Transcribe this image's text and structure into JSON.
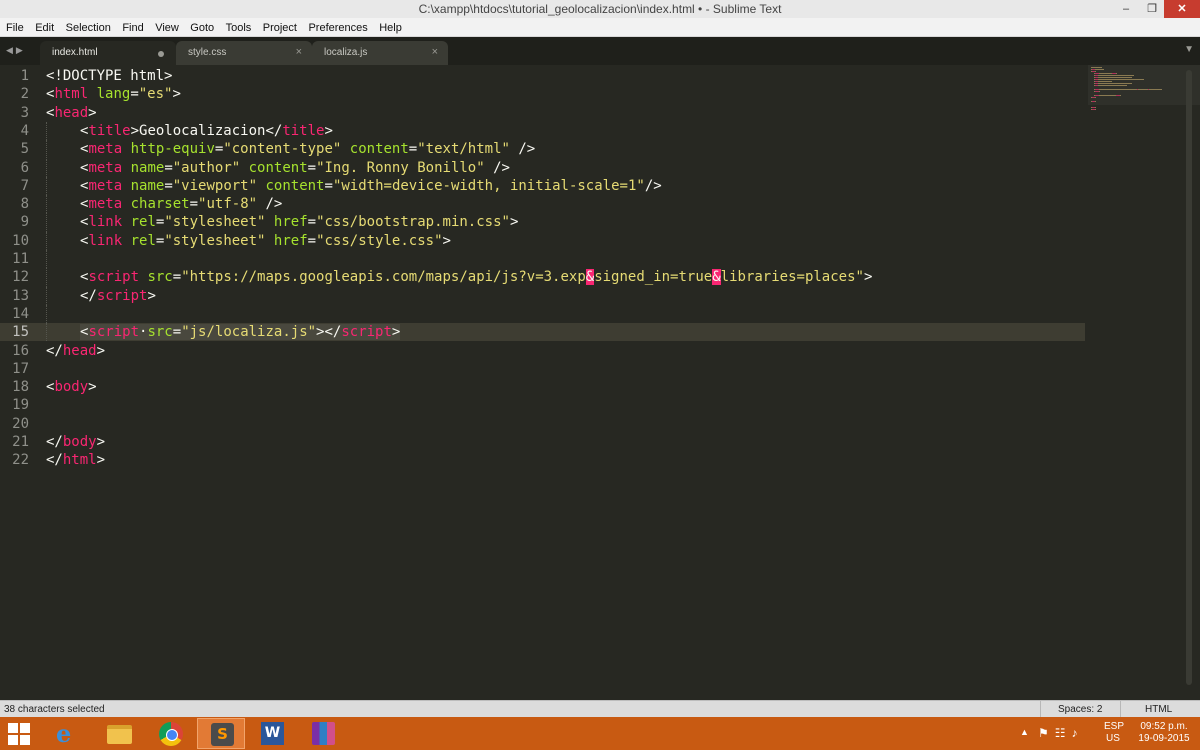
{
  "window": {
    "title": "C:\\xampp\\htdocs\\tutorial_geolocalizacion\\index.html • - Sublime Text",
    "minimize": "–",
    "maximize": "❐",
    "close": "✕"
  },
  "menu": [
    "File",
    "Edit",
    "Selection",
    "Find",
    "View",
    "Goto",
    "Tools",
    "Project",
    "Preferences",
    "Help"
  ],
  "tabs": [
    {
      "label": "index.html",
      "active": true,
      "dirty": true
    },
    {
      "label": "style.css",
      "active": false,
      "close": "×"
    },
    {
      "label": "localiza.js",
      "active": false,
      "close": "×"
    }
  ],
  "tab_nav": "◀▶",
  "tab_dropdown": "▼",
  "editor": {
    "current_line": 15,
    "lines": [
      {
        "n": "1",
        "tokens": [
          [
            "p",
            "<!DOCTYPE html>"
          ]
        ]
      },
      {
        "n": "2",
        "tokens": [
          [
            "p",
            "<"
          ],
          [
            "t",
            "html"
          ],
          [
            "p",
            " "
          ],
          [
            "a",
            "lang"
          ],
          [
            "p",
            "="
          ],
          [
            "s",
            "\"es\""
          ],
          [
            "p",
            ">"
          ]
        ]
      },
      {
        "n": "3",
        "tokens": [
          [
            "p",
            "<"
          ],
          [
            "t",
            "head"
          ],
          [
            "p",
            ">"
          ]
        ]
      },
      {
        "n": "4",
        "indent": true,
        "tokens": [
          [
            "p",
            "<"
          ],
          [
            "t",
            "title"
          ],
          [
            "p",
            ">Geolocalizacion</"
          ],
          [
            "t",
            "title"
          ],
          [
            "p",
            ">"
          ]
        ]
      },
      {
        "n": "5",
        "indent": true,
        "tokens": [
          [
            "p",
            "<"
          ],
          [
            "t",
            "meta"
          ],
          [
            "p",
            " "
          ],
          [
            "a",
            "http-equiv"
          ],
          [
            "p",
            "="
          ],
          [
            "s",
            "\"content-type\""
          ],
          [
            "p",
            " "
          ],
          [
            "a",
            "content"
          ],
          [
            "p",
            "="
          ],
          [
            "s",
            "\"text/html\""
          ],
          [
            "p",
            " />"
          ]
        ]
      },
      {
        "n": "6",
        "indent": true,
        "tokens": [
          [
            "p",
            "<"
          ],
          [
            "t",
            "meta"
          ],
          [
            "p",
            " "
          ],
          [
            "a",
            "name"
          ],
          [
            "p",
            "="
          ],
          [
            "s",
            "\"author\""
          ],
          [
            "p",
            " "
          ],
          [
            "a",
            "content"
          ],
          [
            "p",
            "="
          ],
          [
            "s",
            "\"Ing. Ronny Bonillo\""
          ],
          [
            "p",
            " />"
          ]
        ]
      },
      {
        "n": "7",
        "indent": true,
        "tokens": [
          [
            "p",
            "<"
          ],
          [
            "t",
            "meta"
          ],
          [
            "p",
            " "
          ],
          [
            "a",
            "name"
          ],
          [
            "p",
            "="
          ],
          [
            "s",
            "\"viewport\""
          ],
          [
            "p",
            " "
          ],
          [
            "a",
            "content"
          ],
          [
            "p",
            "="
          ],
          [
            "s",
            "\"width=device-width, initial-scale=1\""
          ],
          [
            "p",
            "/>"
          ]
        ]
      },
      {
        "n": "8",
        "indent": true,
        "tokens": [
          [
            "p",
            "<"
          ],
          [
            "t",
            "meta"
          ],
          [
            "p",
            " "
          ],
          [
            "a",
            "charset"
          ],
          [
            "p",
            "="
          ],
          [
            "s",
            "\"utf-8\""
          ],
          [
            "p",
            " />"
          ]
        ]
      },
      {
        "n": "9",
        "indent": true,
        "tokens": [
          [
            "p",
            "<"
          ],
          [
            "t",
            "link"
          ],
          [
            "p",
            " "
          ],
          [
            "a",
            "rel"
          ],
          [
            "p",
            "="
          ],
          [
            "s",
            "\"stylesheet\""
          ],
          [
            "p",
            " "
          ],
          [
            "a",
            "href"
          ],
          [
            "p",
            "="
          ],
          [
            "s",
            "\"css/bootstrap.min.css\""
          ],
          [
            "p",
            ">"
          ]
        ]
      },
      {
        "n": "10",
        "indent": true,
        "tokens": [
          [
            "p",
            "<"
          ],
          [
            "t",
            "link"
          ],
          [
            "p",
            " "
          ],
          [
            "a",
            "rel"
          ],
          [
            "p",
            "="
          ],
          [
            "s",
            "\"stylesheet\""
          ],
          [
            "p",
            " "
          ],
          [
            "a",
            "href"
          ],
          [
            "p",
            "="
          ],
          [
            "s",
            "\"css/style.css\""
          ],
          [
            "p",
            ">"
          ]
        ]
      },
      {
        "n": "11",
        "indent": true,
        "tokens": []
      },
      {
        "n": "12",
        "indent": true,
        "tokens": [
          [
            "p",
            "<"
          ],
          [
            "t",
            "script"
          ],
          [
            "p",
            " "
          ],
          [
            "a",
            "src"
          ],
          [
            "p",
            "="
          ],
          [
            "s",
            "\"https://maps.googleapis.com/maps/api/js?v=3.exp"
          ],
          [
            "amp",
            "&"
          ],
          [
            "s",
            "signed_in=true"
          ],
          [
            "amp",
            "&"
          ],
          [
            "s",
            "libraries=places\""
          ],
          [
            "p",
            ">"
          ]
        ]
      },
      {
        "n": "13",
        "indent": true,
        "tokens": [
          [
            "p",
            "</"
          ],
          [
            "t",
            "script"
          ],
          [
            "p",
            ">"
          ]
        ]
      },
      {
        "n": "14",
        "indent": true,
        "tokens": []
      },
      {
        "n": "15",
        "indent": true,
        "selected": true,
        "tokens": [
          [
            "p",
            "<"
          ],
          [
            "t",
            "script"
          ],
          [
            "p",
            "·"
          ],
          [
            "a",
            "src"
          ],
          [
            "p",
            "="
          ],
          [
            "s",
            "\"js/localiza.js\""
          ],
          [
            "p",
            "></"
          ],
          [
            "t",
            "script"
          ],
          [
            "p",
            ">"
          ]
        ]
      },
      {
        "n": "16",
        "tokens": [
          [
            "p",
            "</"
          ],
          [
            "t",
            "head"
          ],
          [
            "p",
            ">"
          ]
        ]
      },
      {
        "n": "17",
        "tokens": []
      },
      {
        "n": "18",
        "tokens": [
          [
            "p",
            "<"
          ],
          [
            "t",
            "body"
          ],
          [
            "p",
            ">"
          ]
        ]
      },
      {
        "n": "19",
        "tokens": []
      },
      {
        "n": "20",
        "tokens": []
      },
      {
        "n": "21",
        "tokens": [
          [
            "p",
            "</"
          ],
          [
            "t",
            "body"
          ],
          [
            "p",
            ">"
          ]
        ]
      },
      {
        "n": "22",
        "tokens": [
          [
            "p",
            "</"
          ],
          [
            "t",
            "html"
          ],
          [
            "p",
            ">"
          ]
        ]
      }
    ]
  },
  "status": {
    "left": "38 characters selected",
    "spaces": "Spaces: 2",
    "syntax": "HTML"
  },
  "taskbar": {
    "apps": [
      {
        "name": "internet-explorer",
        "icon": "ie-icon",
        "glyph": "e",
        "active": false
      },
      {
        "name": "file-explorer",
        "icon": "folder-icon",
        "active": false
      },
      {
        "name": "chrome",
        "icon": "chrome-icon",
        "active": false
      },
      {
        "name": "sublime-text",
        "icon": "sublime-icon",
        "glyph": "S",
        "active": true
      },
      {
        "name": "word",
        "icon": "word-icon",
        "glyph": "W",
        "active": false
      },
      {
        "name": "winrar",
        "icon": "winrar-icon",
        "active": false
      }
    ],
    "tray_arrow": "▲",
    "tray_icons": "⚑☷♪",
    "lang_top": "ESP",
    "lang_bottom": "US",
    "time": "09:52 p.m.",
    "date": "19-09-2015"
  },
  "colors": {
    "editor_bg": "#272822",
    "tag": "#f92672",
    "attribute": "#a6e22e",
    "string": "#e6db74",
    "taskbar": "#c85a12"
  }
}
